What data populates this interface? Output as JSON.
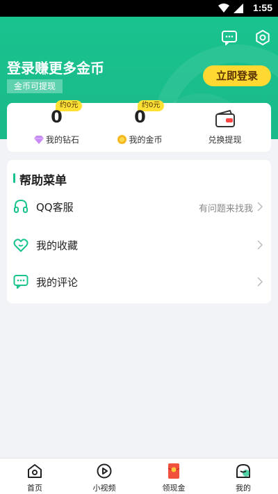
{
  "status": {
    "time": "1:55",
    "icons": [
      "wifi-icon",
      "signal-icon"
    ]
  },
  "header": {
    "icons": [
      "message-icon",
      "settings-icon"
    ],
    "promo_title": "登录赚更多金币",
    "promo_subtitle": "金币可提现",
    "login_label": "立即登录",
    "colors": {
      "primary": "#19c38e",
      "login_button": "#ffd932"
    }
  },
  "stats": {
    "diamond": {
      "badge": "约0元",
      "value": "0",
      "label": "我的钻石",
      "icon": "diamond-icon"
    },
    "coin": {
      "badge": "约0元",
      "value": "0",
      "label": "我的金币",
      "icon": "coin-icon"
    },
    "withdraw": {
      "label": "兑换提现",
      "icon": "wallet-icon"
    }
  },
  "help": {
    "title": "帮助菜单",
    "items": [
      {
        "label": "QQ客服",
        "hint": "有问题来找我",
        "icon": "headset-icon"
      },
      {
        "label": "我的收藏",
        "hint": "",
        "icon": "heart-icon"
      },
      {
        "label": "我的评论",
        "hint": "",
        "icon": "comment-icon"
      }
    ]
  },
  "tabs": [
    {
      "label": "首页",
      "icon": "home-icon"
    },
    {
      "label": "小视频",
      "icon": "video-icon"
    },
    {
      "label": "领现金",
      "icon": "red-envelope-icon"
    },
    {
      "label": "我的",
      "icon": "profile-icon"
    }
  ]
}
